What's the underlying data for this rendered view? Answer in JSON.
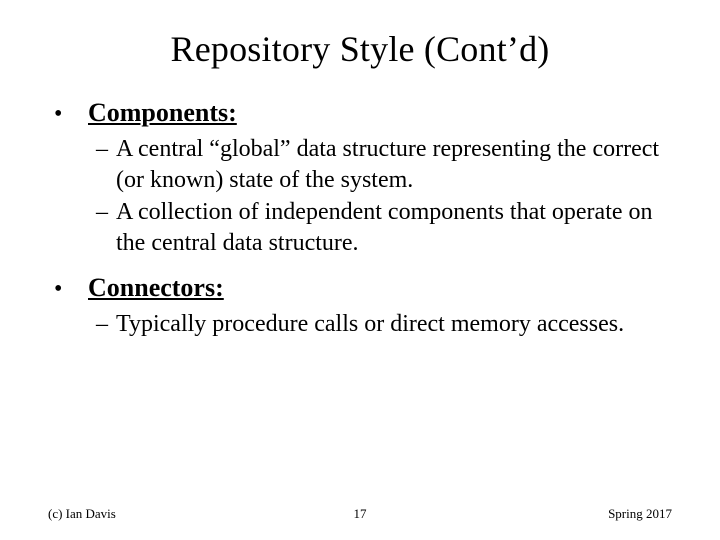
{
  "title": "Repository Style (Cont’d)",
  "sections": [
    {
      "heading": "Components:",
      "items": [
        "A central “global” data structure representing the correct (or known) state of the system.",
        "A collection of independent components that operate on the central data structure."
      ]
    },
    {
      "heading": "Connectors:",
      "items": [
        "Typically procedure calls or direct memory accesses."
      ]
    }
  ],
  "footer": {
    "left": "(c) Ian Davis",
    "center": "17",
    "right": "Spring 2017"
  }
}
